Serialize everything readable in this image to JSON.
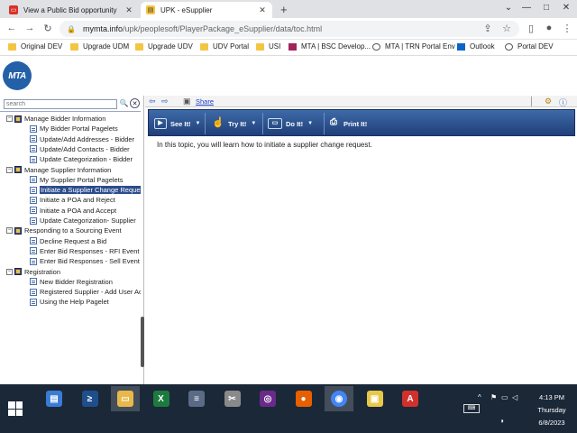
{
  "browser": {
    "tabs": [
      {
        "title": "View a Public Bid opportunity",
        "active": false
      },
      {
        "title": "UPK - eSupplier",
        "active": true
      }
    ],
    "new_tab": "+",
    "window_controls": [
      "⌄",
      "—",
      "□",
      "✕"
    ],
    "address": {
      "host": "mymta.info",
      "path": "/upk/peoplesoft/PlayerPackage_eSupplier/data/toc.html"
    },
    "bookmarks": [
      {
        "label": "Original DEV",
        "icon": "folder-icon"
      },
      {
        "label": "Upgrade UDM",
        "icon": "folder-icon"
      },
      {
        "label": "Upgrade UDV",
        "icon": "folder-icon"
      },
      {
        "label": "UDV Portal",
        "icon": "folder-icon"
      },
      {
        "label": "USI",
        "icon": "folder-icon"
      },
      {
        "label": "MTA | BSC Develop...",
        "icon": "mta-icon"
      },
      {
        "label": "MTA | TRN Portal Env",
        "icon": "globe-icon"
      },
      {
        "label": "Outlook",
        "icon": "outlook-icon"
      },
      {
        "label": "Portal DEV",
        "icon": "globe-icon"
      }
    ]
  },
  "app": {
    "logo": "MTA",
    "search_placeholder": "search",
    "share_label": "Share",
    "modes": [
      {
        "label": "See It!",
        "icon": "play-icon"
      },
      {
        "label": "Try It!",
        "icon": "hand-icon"
      },
      {
        "label": "Do It!",
        "icon": "window-icon"
      },
      {
        "label": "Print It!",
        "icon": "print-icon"
      }
    ],
    "content_text": "In this topic, you will learn how to initiate a supplier change request.",
    "tree": [
      {
        "label": "Manage Bidder Information",
        "level": 0,
        "type": "book",
        "expander": "−"
      },
      {
        "label": "My Bidder Portal Pagelets",
        "level": 1,
        "type": "topic"
      },
      {
        "label": "Update/Add Addresses - Bidder",
        "level": 1,
        "type": "topic"
      },
      {
        "label": "Update/Add Contacts - Bidder",
        "level": 1,
        "type": "topic"
      },
      {
        "label": "Update Categorization - Bidder",
        "level": 1,
        "type": "topic"
      },
      {
        "label": "Manage Supplier Information",
        "level": 0,
        "type": "book",
        "expander": "−"
      },
      {
        "label": "My Supplier Portal Pagelets",
        "level": 1,
        "type": "topic"
      },
      {
        "label": "Initiate a Supplier Change Request",
        "level": 1,
        "type": "topic",
        "selected": true
      },
      {
        "label": "Initiate a POA and Reject",
        "level": 1,
        "type": "topic"
      },
      {
        "label": "Initiate a POA and Accept",
        "level": 1,
        "type": "topic"
      },
      {
        "label": "Update Categorization- Supplier",
        "level": 1,
        "type": "topic"
      },
      {
        "label": "Responding to a Sourcing Event",
        "level": 0,
        "type": "book",
        "expander": "−"
      },
      {
        "label": "Decline Request a Bid",
        "level": 1,
        "type": "topic"
      },
      {
        "label": "Enter Bid Responses - RFI Event",
        "level": 1,
        "type": "topic"
      },
      {
        "label": "Enter Bid Responses - Sell Event",
        "level": 1,
        "type": "topic"
      },
      {
        "label": "Registration",
        "level": 0,
        "type": "book",
        "expander": "−"
      },
      {
        "label": "New Bidder Registration",
        "level": 1,
        "type": "topic"
      },
      {
        "label": "Registered Supplier - Add User Account",
        "level": 1,
        "type": "topic"
      },
      {
        "label": "Using the Help Pagelet",
        "level": 1,
        "type": "topic"
      }
    ]
  },
  "taskbar": {
    "apps": [
      {
        "name": "file-server-icon",
        "glyph": "▤"
      },
      {
        "name": "powershell-icon",
        "glyph": "≥"
      },
      {
        "name": "file-explorer-icon",
        "glyph": "▭"
      },
      {
        "name": "excel-icon",
        "glyph": "X"
      },
      {
        "name": "database-icon",
        "glyph": "≡"
      },
      {
        "name": "tools-icon",
        "glyph": "✂"
      },
      {
        "name": "mask-app-icon",
        "glyph": "◎"
      },
      {
        "name": "firefox-icon",
        "glyph": "●"
      },
      {
        "name": "chrome-icon",
        "glyph": "◉"
      },
      {
        "name": "remote-desktop-icon",
        "glyph": "▣"
      },
      {
        "name": "acrobat-icon",
        "glyph": "A"
      }
    ],
    "time": "4:13 PM",
    "day": "Thursday",
    "date": "6/8/2023"
  }
}
